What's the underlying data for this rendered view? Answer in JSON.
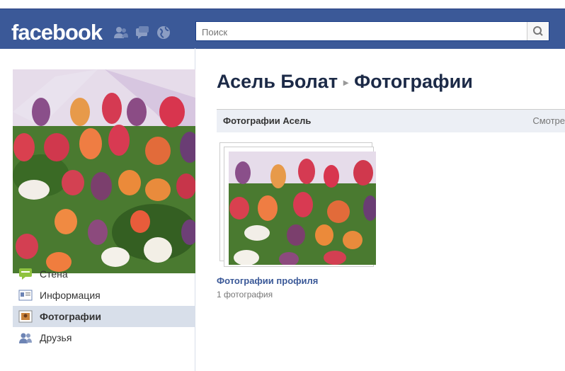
{
  "header": {
    "logo": "facebook",
    "search_placeholder": "Поиск",
    "icons": [
      "friend-requests-icon",
      "messages-icon",
      "notifications-globe-icon",
      "search-icon"
    ]
  },
  "sidebar": {
    "items": [
      {
        "label": "Стена",
        "icon": "wall-icon",
        "active": false
      },
      {
        "label": "Информация",
        "icon": "info-icon",
        "active": false
      },
      {
        "label": "Фотографии",
        "icon": "photos-icon",
        "active": true
      },
      {
        "label": "Друзья",
        "icon": "friends-icon",
        "active": false
      }
    ]
  },
  "main": {
    "breadcrumb_name": "Асель Болат",
    "breadcrumb_separator": "▸",
    "breadcrumb_section": "Фотографии",
    "bar_label": "Фотографии Асель",
    "bar_right": "Смотре",
    "album": {
      "title": "Фотографии профиля",
      "count": "1 фотография"
    }
  },
  "colors": {
    "brand_blue": "#3b5998",
    "link": "#3b5998",
    "sidebar_active": "#d8dfea",
    "bar_bg": "#eceff5"
  }
}
